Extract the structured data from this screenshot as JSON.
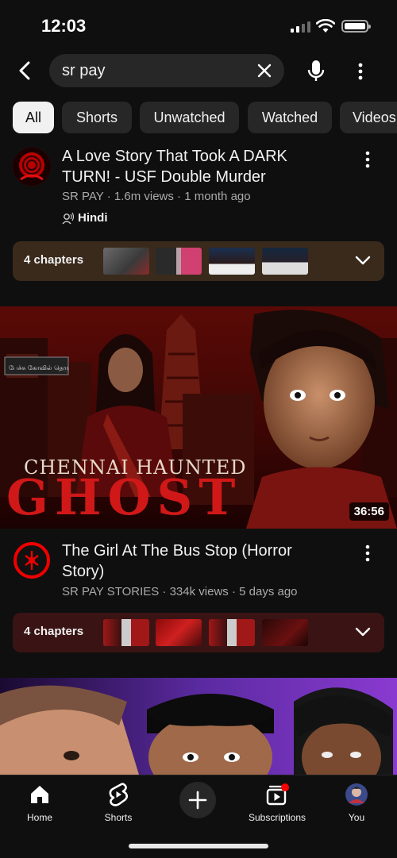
{
  "status_bar": {
    "time": "12:03"
  },
  "search": {
    "query": "sr pay"
  },
  "chips": [
    "All",
    "Shorts",
    "Unwatched",
    "Watched",
    "Videos"
  ],
  "videos": [
    {
      "title": "A Love Story That Took A DARK TURN! - USF Double Murder",
      "channel": "SR PAY",
      "views": "1.6m views",
      "age": "1 month ago",
      "meta": "SR PAY · 1.6m views · 1 month ago",
      "language": "Hindi",
      "chapters_label": "4 chapters"
    },
    {
      "title": "The Girl At The Bus Stop (Horror Story)",
      "channel": "SR PAY STORIES",
      "meta": "SR PAY STORIES · 334k views · 5 days ago",
      "chapters_label": "4 chapters",
      "thumbnail_title_line1": "CHENNAI HAUNTED",
      "thumbnail_title_line2": "GHOST",
      "thumbnail_sign": "பேச்சு கோவில் தெரு",
      "duration": "36:56"
    }
  ],
  "bottom_nav": {
    "home": "Home",
    "shorts": "Shorts",
    "subscriptions": "Subscriptions",
    "you": "You"
  },
  "colors": {
    "background": "#0f0f0f",
    "chip_bg": "#272727",
    "chip_active_bg": "#f1f1f1",
    "chapters_bar_1": "#3a2a1c",
    "chapters_bar_2": "#3a1414",
    "notification_dot": "#ff0000"
  }
}
